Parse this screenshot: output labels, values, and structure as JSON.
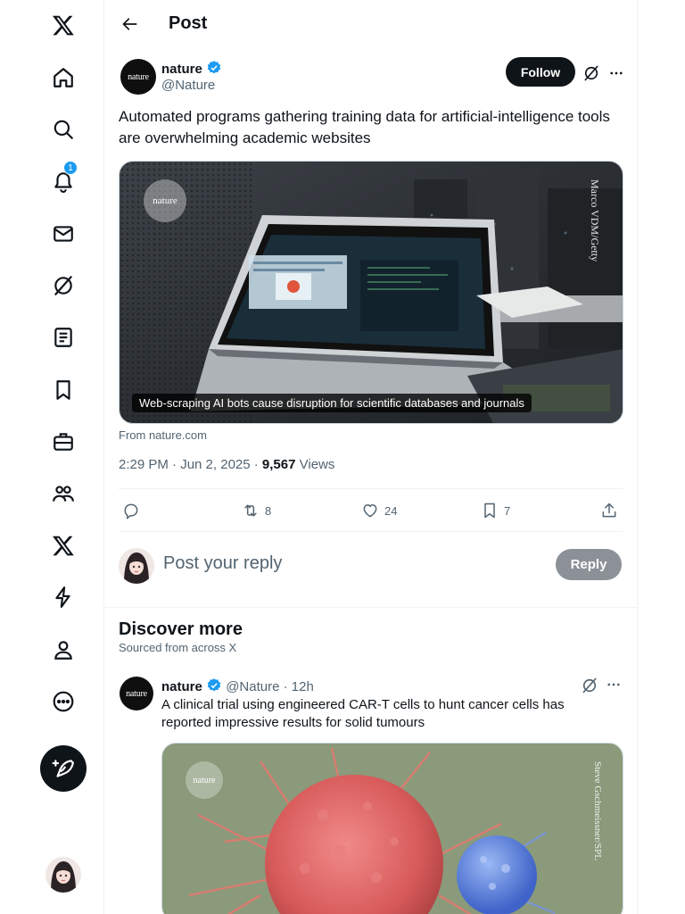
{
  "nav": {
    "items": [
      {
        "name": "x-logo-icon"
      },
      {
        "name": "home-icon"
      },
      {
        "name": "search-icon"
      },
      {
        "name": "notifications-icon",
        "badge": "1"
      },
      {
        "name": "messages-icon"
      },
      {
        "name": "grok-icon"
      },
      {
        "name": "lists-icon"
      },
      {
        "name": "bookmarks-icon"
      },
      {
        "name": "jobs-icon"
      },
      {
        "name": "communities-icon"
      },
      {
        "name": "premium-icon"
      },
      {
        "name": "verified-orgs-icon"
      },
      {
        "name": "profile-icon"
      },
      {
        "name": "more-icon"
      }
    ],
    "compose_icon": "compose-icon"
  },
  "header": {
    "title": "Post"
  },
  "post": {
    "author_name": "nature",
    "author_handle": "@Nature",
    "avatar_text": "nature",
    "follow_label": "Follow",
    "text": "Automated programs gathering training data for artificial-intelligence tools are overwhelming academic websites",
    "card": {
      "logo_text": "nature",
      "credit": "Marco VDM/Getty",
      "caption": "Web-scraping AI bots cause disruption for scientific databases and journals",
      "from": "From nature.com"
    },
    "time": "2:29 PM · Jun 2, 2025 · ",
    "views_count": "9,567",
    "views_label": " Views",
    "stats": {
      "replies": "",
      "reposts": "8",
      "likes": "24",
      "bookmarks": "7"
    }
  },
  "reply": {
    "placeholder": "Post your reply",
    "button_label": "Reply"
  },
  "discover": {
    "title": "Discover more",
    "subtitle": "Sourced from across X"
  },
  "tweet2": {
    "author_name": "nature",
    "author_handle": "@Nature",
    "time": "· 12h",
    "avatar_text": "nature",
    "text": "A clinical trial using engineered CAR-T cells to hunt cancer cells has reported impressive results for solid tumours",
    "media": {
      "logo_text": "nature",
      "credit": "Steve Gschmeissner/SPL"
    }
  },
  "colors": {
    "accent": "#1d9bf0",
    "text": "#0f1419",
    "muted": "#536471",
    "border": "#eff3f4"
  }
}
